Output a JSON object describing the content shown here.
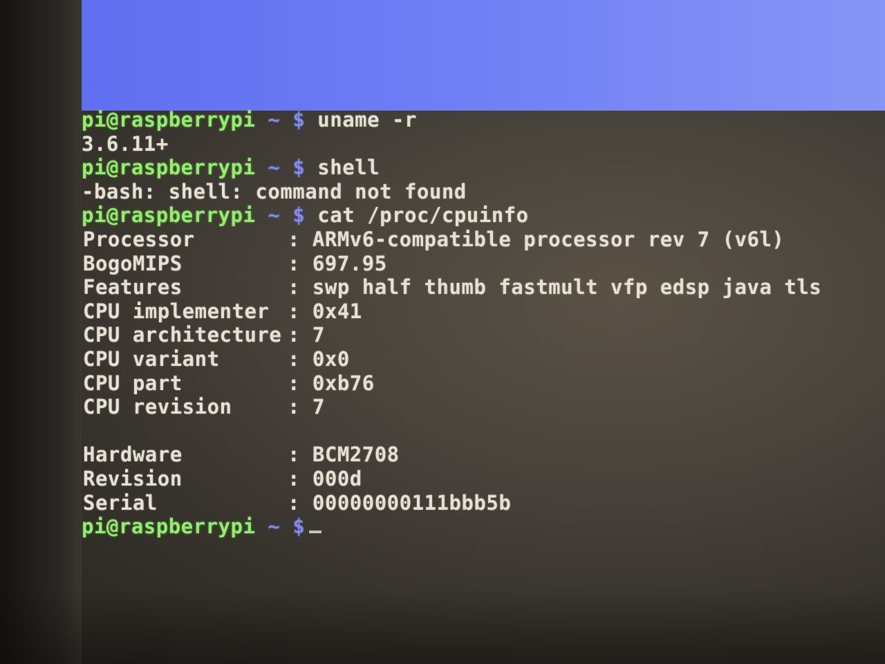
{
  "prompt": {
    "user_host": "pi@raspberrypi",
    "dir": "~",
    "symbol": "$"
  },
  "history": [
    {
      "command": "uname -r",
      "output": [
        "3.6.11+"
      ]
    },
    {
      "command": "shell",
      "output": [
        "-bash: shell: command not found"
      ]
    },
    {
      "command": "cat /proc/cpuinfo"
    }
  ],
  "cpuinfo": [
    {
      "key": "Processor",
      "value": "ARMv6-compatible processor rev 7 (v6l)"
    },
    {
      "key": "BogoMIPS",
      "value": "697.95"
    },
    {
      "key": "Features",
      "value": "swp half thumb fastmult vfp edsp java tls"
    },
    {
      "key": "CPU implementer",
      "value": "0x41"
    },
    {
      "key": "CPU architecture",
      "value": "7"
    },
    {
      "key": "CPU variant",
      "value": "0x0"
    },
    {
      "key": "CPU part",
      "value": "0xb76"
    },
    {
      "key": "CPU revision",
      "value": "7"
    }
  ],
  "hardware": [
    {
      "key": "Hardware",
      "value": "BCM2708"
    },
    {
      "key": "Revision",
      "value": "000d"
    },
    {
      "key": "Serial",
      "value": "00000000111bbb5b"
    }
  ],
  "colors": {
    "prompt_user": "#8ff06a",
    "prompt_symbol": "#7f8cf2",
    "text": "#e6e1d4",
    "desktop": "#6e7ef4"
  }
}
